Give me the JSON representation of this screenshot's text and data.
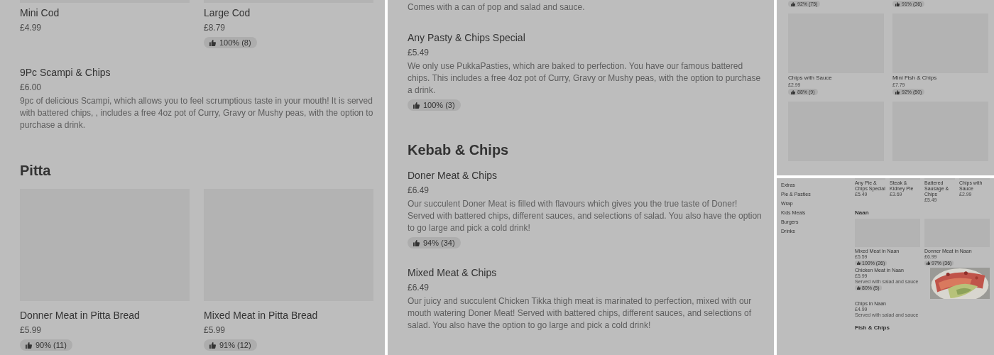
{
  "panels": [
    {
      "kind": "full",
      "sections": [
        {
          "items": [
            {
              "kind": "cut-card",
              "name": "Mini Cod",
              "price": "£4.99"
            },
            {
              "kind": "cut-card",
              "name": "Large Cod",
              "price": "£8.79",
              "rating": "100% (8)"
            },
            {
              "kind": "row",
              "name": "9Pc Scampi & Chips",
              "price": "£6.00",
              "description": "9pc of delicious Scampi, which allows you to feel scrumptious taste in your mouth! It is served with battered chips, , includes a free 4oz pot of Curry, Gravy or Mushy peas, with the option to purchase a drink."
            }
          ]
        },
        {
          "heading": "Pitta",
          "items": [
            {
              "kind": "card",
              "name": "Donner Meat in Pitta Bread",
              "price": "£5.99",
              "rating": "90% (11)"
            },
            {
              "kind": "card",
              "name": "Mixed Meat in Pitta Bread",
              "price": "£5.99",
              "rating": "91% (12)"
            }
          ]
        }
      ]
    },
    {
      "kind": "full",
      "sections": [
        {
          "items": [
            {
              "kind": "row",
              "description": "Comes with a can of pop and salad and sauce."
            },
            {
              "kind": "row",
              "name": "Any Pasty & Chips Special",
              "price": "£5.49",
              "description": "We only use PukkaPasties, which are baked to perfection. You have our famous battered chips. This includes a free 4oz pot of Curry, Gravy or Mushy peas, with the option to purchase a drink.",
              "rating": "100% (3)"
            }
          ]
        },
        {
          "heading": "Kebab & Chips",
          "items": [
            {
              "kind": "row",
              "name": "Doner Meat & Chips",
              "price": "£6.49",
              "description": "Our succulent Doner Meat is filled with flavours which gives you the true taste of Doner! Served with battered chips, different sauces, and selections of salad. You also have the option to go large and pick a cold drink!",
              "rating": "94% (34)"
            },
            {
              "kind": "row",
              "name": "Mixed Meat & Chips",
              "price": "£6.49",
              "description": "Our juicy and succulent Chicken Tikka thigh meat is marinated to perfection, mixed with our mouth watering Doner Meat! Served with battered chips, different sauces, and selections of salad. You also have the option to go large and pick a cold drink!"
            }
          ]
        }
      ]
    },
    {
      "kind": "compact",
      "sections": [
        {
          "items": [
            {
              "kind": "text-card",
              "rating": "92% (75)"
            },
            {
              "kind": "text-card",
              "rating": "91% (36)"
            },
            {
              "kind": "card",
              "name": "Chips with Sauce",
              "price": "£2.99",
              "rating": "88% (9)"
            },
            {
              "kind": "card",
              "name": "Mini Fish & Chips",
              "price": "£7.79",
              "rating": "92% (50)"
            },
            {
              "kind": "card"
            },
            {
              "kind": "card"
            }
          ]
        }
      ]
    },
    {
      "kind": "mini",
      "sidebar": [
        "Extras",
        "Pie & Pasties",
        "Wrap",
        "Kids Meals",
        "Burgers",
        "Drinks"
      ],
      "sections": [
        {
          "items": [
            {
              "kind": "cut-card",
              "name": "Any Pie & Chips Special",
              "price": "£5.49"
            },
            {
              "kind": "cut-card",
              "name": "Steak & Kidney Pie",
              "price": "£3.69"
            },
            {
              "kind": "cut-card",
              "name": "Battered Sausage & Chips",
              "price": "£5.49"
            },
            {
              "kind": "cut-card",
              "name": "Chips with Sauce",
              "price": "£2.99"
            }
          ]
        },
        {
          "heading": "Naan",
          "items": [
            {
              "kind": "card",
              "name": "Mixed Meat in Naan",
              "price": "£5.59",
              "rating": "100% (26)"
            },
            {
              "kind": "card",
              "name": "Donner Meat in Naan",
              "price": "£6.99",
              "rating": "97% (36)"
            },
            {
              "kind": "photo-row",
              "name": "Chicken Meat in Naan",
              "price": "£5.99",
              "description": "Served with salad and sauce",
              "rating": "80% (5)"
            },
            {
              "kind": "row",
              "name": "Chips in Naan",
              "price": "£4.99",
              "description": "Served with salad and sauce"
            }
          ]
        },
        {
          "heading": "Fish & Chips"
        }
      ]
    }
  ]
}
